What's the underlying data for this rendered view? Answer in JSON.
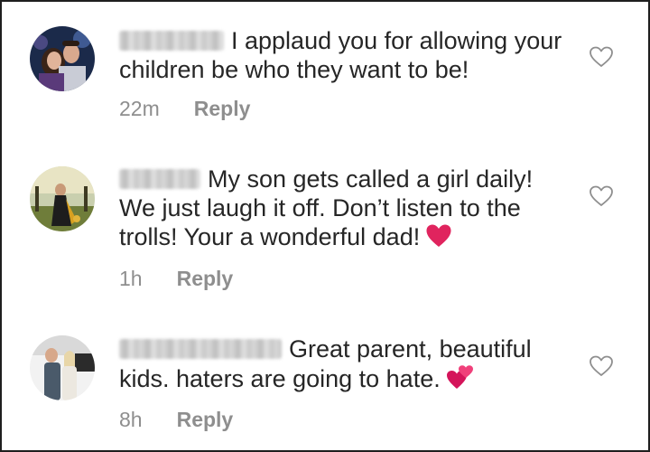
{
  "comments": [
    {
      "text": "I applaud you for allowing your children be who they want to be!",
      "time": "22m",
      "reply_label": "Reply",
      "avatar_icon": "profile-photo-couple",
      "like_icon": "heart-outline-icon"
    },
    {
      "text": "My son gets called a girl daily! We just laugh it off.  Don’t listen to the trolls! Your a wonderful dad!",
      "time": "1h",
      "reply_label": "Reply",
      "avatar_icon": "profile-photo-outdoor",
      "emoji": "red-heart",
      "like_icon": "heart-outline-icon"
    },
    {
      "text": "Great parent, beautiful kids.  haters are going to hate.",
      "time": "8h",
      "reply_label": "Reply",
      "avatar_icon": "profile-photo-pair",
      "emoji": "two-hearts",
      "like_icon": "heart-outline-icon"
    }
  ],
  "colors": {
    "text": "#262626",
    "meta": "#8e8e8e",
    "heart_red": "#e0245e",
    "border": "#1f1f1f"
  }
}
